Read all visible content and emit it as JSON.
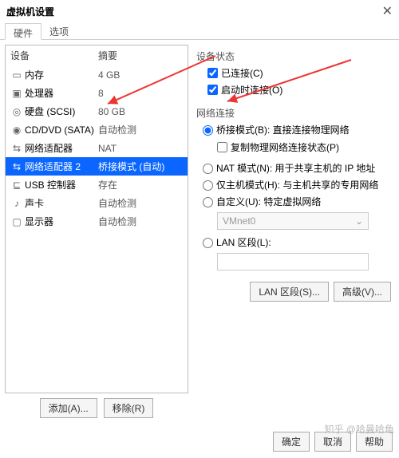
{
  "window": {
    "title": "虚拟机设置",
    "close": "✕"
  },
  "tabs": {
    "hardware": "硬件",
    "options": "选项"
  },
  "devlist": {
    "hdr_device": "设备",
    "hdr_summary": "摘要",
    "rows": [
      {
        "name": "内存",
        "summary": "4 GB",
        "icon": "▭"
      },
      {
        "name": "处理器",
        "summary": "8",
        "icon": "▣"
      },
      {
        "name": "硬盘 (SCSI)",
        "summary": "80 GB",
        "icon": "◎"
      },
      {
        "name": "CD/DVD (SATA)",
        "summary": "自动检测",
        "icon": "◉"
      },
      {
        "name": "网络适配器",
        "summary": "NAT",
        "icon": "⇆"
      },
      {
        "name": "网络适配器 2",
        "summary": "桥接模式 (自动)",
        "icon": "⇆"
      },
      {
        "name": "USB 控制器",
        "summary": "存在",
        "icon": "⊑"
      },
      {
        "name": "声卡",
        "summary": "自动检测",
        "icon": "♪"
      },
      {
        "name": "显示器",
        "summary": "自动检测",
        "icon": "▢"
      }
    ],
    "add_btn": "添加(A)...",
    "remove_btn": "移除(R)"
  },
  "right": {
    "status_title": "设备状态",
    "chk_connected": "已连接(C)",
    "chk_connect_on": "启动时连接(O)",
    "net_title": "网络连接",
    "rad_bridged": "桥接模式(B): 直接连接物理网络",
    "chk_replicate": "复制物理网络连接状态(P)",
    "rad_nat": "NAT 模式(N): 用于共享主机的 IP 地址",
    "rad_hostonly": "仅主机模式(H): 与主机共享的专用网络",
    "rad_custom": "自定义(U): 特定虚拟网络",
    "vmnet": "VMnet0",
    "rad_lan": "LAN 区段(L):",
    "btn_lan": "LAN 区段(S)...",
    "btn_adv": "高级(V)..."
  },
  "dlg": {
    "ok": "确定",
    "cancel": "取消",
    "help": "帮助"
  },
  "watermark": "知乎 @哈曼哈龟"
}
